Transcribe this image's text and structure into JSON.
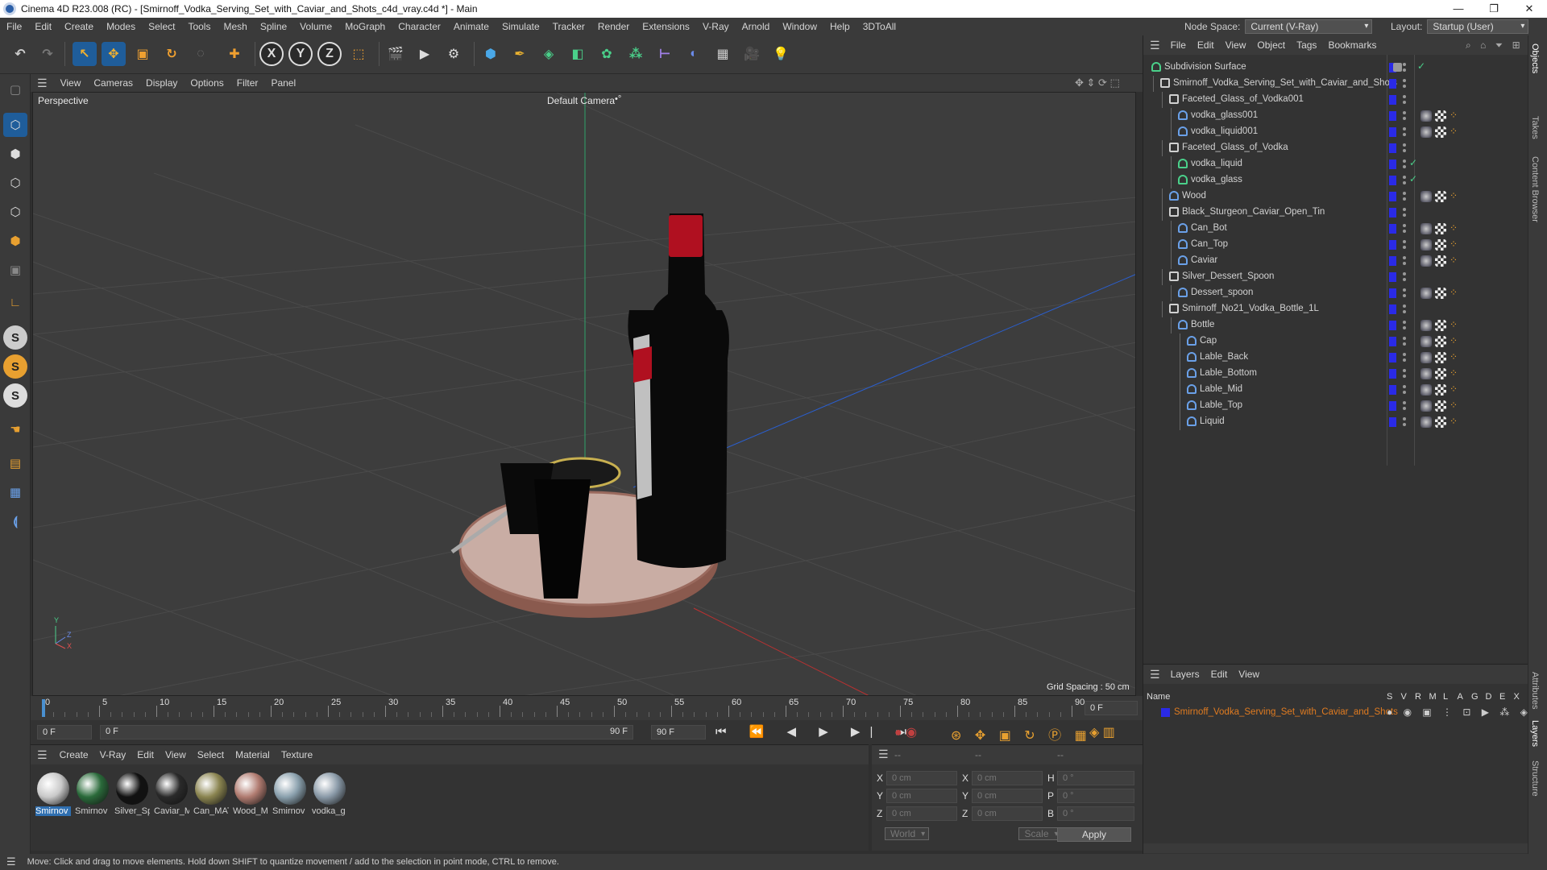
{
  "titlebar": {
    "title": "Cinema 4D R23.008 (RC) - [Smirnoff_Vodka_Serving_Set_with_Caviar_and_Shots_c4d_vray.c4d *] - Main",
    "minimize": "—",
    "maximize": "❐",
    "close": "✕"
  },
  "menubar": {
    "items": [
      "File",
      "Edit",
      "Create",
      "Modes",
      "Select",
      "Tools",
      "Mesh",
      "Spline",
      "Volume",
      "MoGraph",
      "Character",
      "Animate",
      "Simulate",
      "Tracker",
      "Render",
      "Extensions",
      "V-Ray",
      "Arnold",
      "Window",
      "Help",
      "3DToAll"
    ],
    "node_space_label": "Node Space:",
    "node_space_value": "Current (V-Ray)",
    "layout_label": "Layout:",
    "layout_value": "Startup (User)"
  },
  "viewport": {
    "menu": [
      "View",
      "Cameras",
      "Display",
      "Options",
      "Filter",
      "Panel"
    ],
    "label": "Perspective",
    "camera": "Default Camera",
    "camera_icon": "•°",
    "grid_spacing": "Grid Spacing : 50 cm",
    "axis": {
      "y": "Y",
      "z": "Z",
      "x": "X"
    }
  },
  "timeline": {
    "ticks": [
      "0",
      "5",
      "10",
      "15",
      "20",
      "25",
      "30",
      "35",
      "40",
      "45",
      "50",
      "55",
      "60",
      "65",
      "70",
      "75",
      "80",
      "85",
      "90"
    ],
    "current_frame": "0 F",
    "start": "0 F",
    "range_start": "0 F",
    "range_end": "90 F",
    "end": "90 F"
  },
  "material_manager": {
    "menu": [
      "Create",
      "V-Ray",
      "Edit",
      "View",
      "Select",
      "Material",
      "Texture"
    ],
    "materials": [
      {
        "label": "Smirnov",
        "color": "#c9c9c9"
      },
      {
        "label": "Smirnov",
        "color": "#2a6a3a"
      },
      {
        "label": "Silver_Sp",
        "color": "#111111"
      },
      {
        "label": "Caviar_M",
        "color": "#2a2a2a"
      },
      {
        "label": "Can_MAT",
        "color": "#8a8450"
      },
      {
        "label": "Wood_M",
        "color": "#b07b70"
      },
      {
        "label": "Smirnov",
        "color": "#8aa0ad"
      },
      {
        "label": "vodka_g",
        "color": "#8a9aa8"
      }
    ]
  },
  "coordinates": {
    "headers": [
      "--",
      "--",
      "--"
    ],
    "rows": [
      {
        "a": "X",
        "av": "0 cm",
        "b": "X",
        "bv": "0 cm",
        "c": "H",
        "cv": "0 °"
      },
      {
        "a": "Y",
        "av": "0 cm",
        "b": "Y",
        "bv": "0 cm",
        "c": "P",
        "cv": "0 °"
      },
      {
        "a": "Z",
        "av": "0 cm",
        "b": "Z",
        "bv": "0 cm",
        "c": "B",
        "cv": "0 °"
      }
    ],
    "mode_world": "World",
    "mode_scale": "Scale",
    "apply": "Apply"
  },
  "object_manager": {
    "menu": [
      "File",
      "Edit",
      "View",
      "Object",
      "Tags",
      "Bookmarks"
    ],
    "objects": [
      {
        "name": "Subdivision Surface",
        "indent": 0,
        "type": "subdiv",
        "tags": "check"
      },
      {
        "name": "Smirnoff_Vodka_Serving_Set_with_Caviar_and_Shots",
        "indent": 1,
        "type": "null",
        "tags": ""
      },
      {
        "name": "Faceted_Glass_of_Vodka001",
        "indent": 2,
        "type": "null",
        "tags": ""
      },
      {
        "name": "vodka_glass001",
        "indent": 3,
        "type": "poly",
        "tags": "mat"
      },
      {
        "name": "vodka_liquid001",
        "indent": 3,
        "type": "poly",
        "tags": "mat"
      },
      {
        "name": "Faceted_Glass_of_Vodka",
        "indent": 2,
        "type": "null",
        "tags": ""
      },
      {
        "name": "vodka_liquid",
        "indent": 3,
        "type": "green",
        "tags": "check"
      },
      {
        "name": "vodka_glass",
        "indent": 3,
        "type": "green",
        "tags": "check"
      },
      {
        "name": "Wood",
        "indent": 2,
        "type": "poly",
        "tags": "mat"
      },
      {
        "name": "Black_Sturgeon_Caviar_Open_Tin",
        "indent": 2,
        "type": "null",
        "tags": ""
      },
      {
        "name": "Can_Bot",
        "indent": 3,
        "type": "poly",
        "tags": "mat"
      },
      {
        "name": "Can_Top",
        "indent": 3,
        "type": "poly",
        "tags": "mat"
      },
      {
        "name": "Caviar",
        "indent": 3,
        "type": "poly",
        "tags": "mat"
      },
      {
        "name": "Silver_Dessert_Spoon",
        "indent": 2,
        "type": "null",
        "tags": ""
      },
      {
        "name": "Dessert_spoon",
        "indent": 3,
        "type": "poly",
        "tags": "mat"
      },
      {
        "name": "Smirnoff_No21_Vodka_Bottle_1L",
        "indent": 2,
        "type": "null",
        "tags": ""
      },
      {
        "name": "Bottle",
        "indent": 3,
        "type": "poly",
        "tags": "mat"
      },
      {
        "name": "Cap",
        "indent": 4,
        "type": "poly",
        "tags": "mat"
      },
      {
        "name": "Lable_Back",
        "indent": 4,
        "type": "poly",
        "tags": "mat"
      },
      {
        "name": "Lable_Bottom",
        "indent": 4,
        "type": "poly",
        "tags": "mat"
      },
      {
        "name": "Lable_Mid",
        "indent": 4,
        "type": "poly",
        "tags": "mat"
      },
      {
        "name": "Lable_Top",
        "indent": 4,
        "type": "poly",
        "tags": "mat"
      },
      {
        "name": "Liquid",
        "indent": 4,
        "type": "poly",
        "tags": "mat"
      }
    ]
  },
  "layers": {
    "menu": [
      "Layers",
      "Edit",
      "View"
    ],
    "name_header": "Name",
    "flags": [
      "S",
      "V",
      "R",
      "M",
      "L",
      "A",
      "G",
      "D",
      "E",
      "X"
    ],
    "items": [
      {
        "name": "Smirnoff_Vodka_Serving_Set_with_Caviar_and_Shots",
        "color": "#e07b20"
      }
    ]
  },
  "right_tabs": [
    "Objects",
    "Takes",
    "Content Browser",
    "Attributes",
    "Layers",
    "Structure"
  ],
  "status": "Move: Click and drag to move elements. Hold down SHIFT to quantize movement / add to the selection in point mode, CTRL to remove."
}
